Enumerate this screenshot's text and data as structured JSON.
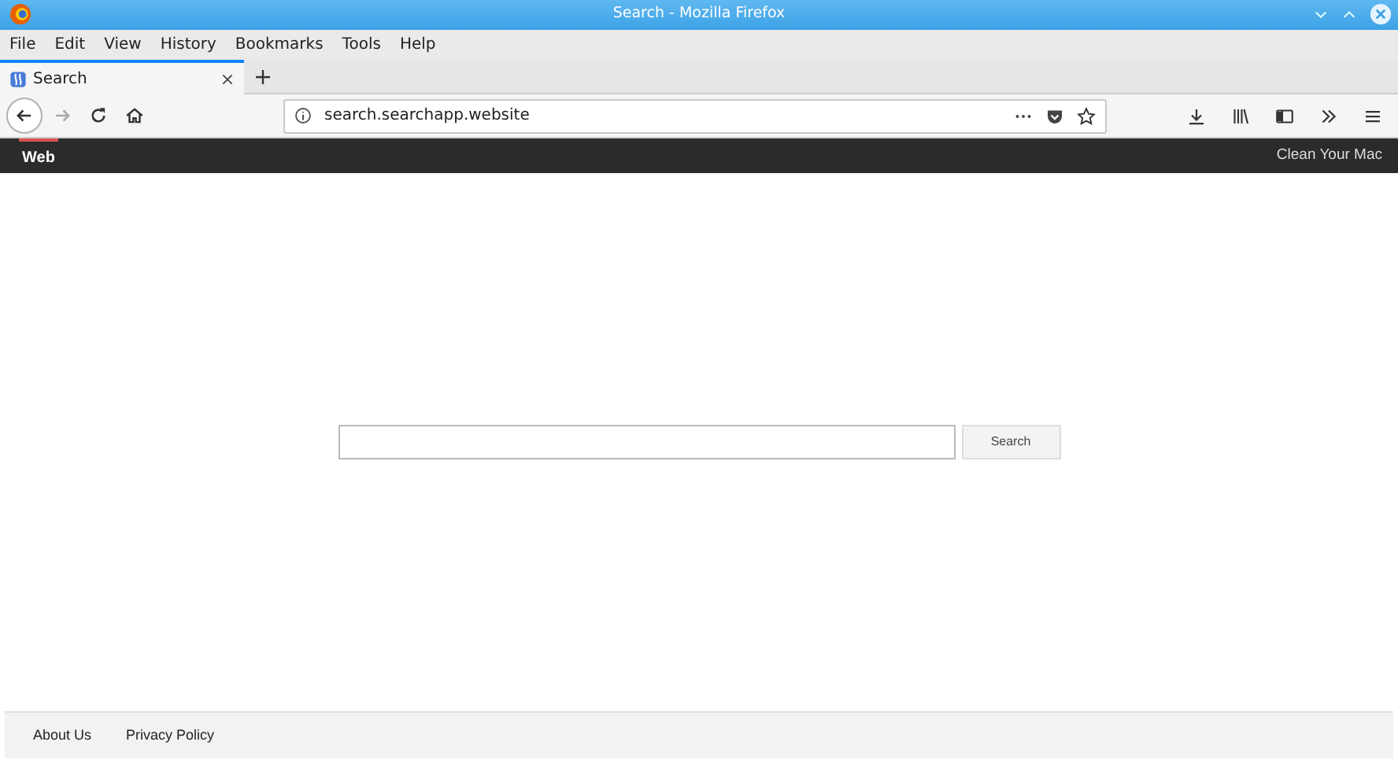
{
  "window": {
    "title": "Search - Mozilla Firefox"
  },
  "menu": [
    "File",
    "Edit",
    "View",
    "History",
    "Bookmarks",
    "Tools",
    "Help"
  ],
  "tabs": [
    {
      "label": "Search",
      "selected": true
    }
  ],
  "nav_buttons": [
    {
      "kind": "back",
      "disabled": false
    },
    {
      "kind": "forward",
      "disabled": true
    },
    {
      "kind": "reload",
      "disabled": false
    },
    {
      "kind": "home",
      "disabled": false
    }
  ],
  "address_bar": {
    "url": "search.searchapp.website"
  },
  "site_nav": {
    "items": [
      {
        "label": "Web",
        "selected": true
      }
    ],
    "right_link": "Clean Your Mac"
  },
  "search": {
    "button": "Search"
  },
  "footer": {
    "links": [
      "About Us",
      "Privacy Policy"
    ]
  }
}
